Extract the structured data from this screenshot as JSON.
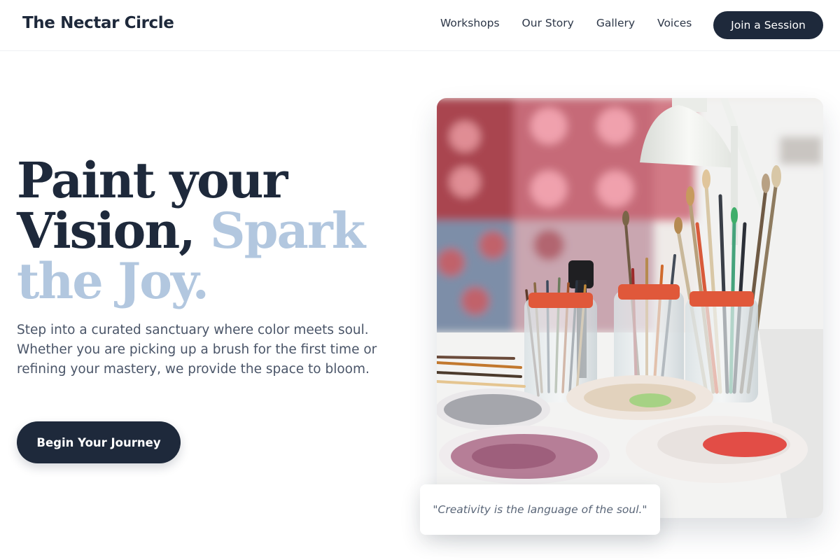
{
  "header": {
    "brand": "The Nectar Circle",
    "nav": [
      "Workshops",
      "Our Story",
      "Gallery",
      "Voices"
    ],
    "cta_label": "Join a Session"
  },
  "hero": {
    "headline_part1": "Paint your Vision,",
    "headline_accent": "Spark the Joy.",
    "subtext": "Step into a curated sanctuary where color meets soul. Whether you are picking up a brush for the first time or refining your mastery, we provide the space to bloom.",
    "cta_label": "Begin Your Journey",
    "quote": "\"Creativity is the language of the soul.\""
  },
  "colors": {
    "primary": "#1e293b",
    "accent": "#b2c7df",
    "body_text": "#4a5568"
  }
}
